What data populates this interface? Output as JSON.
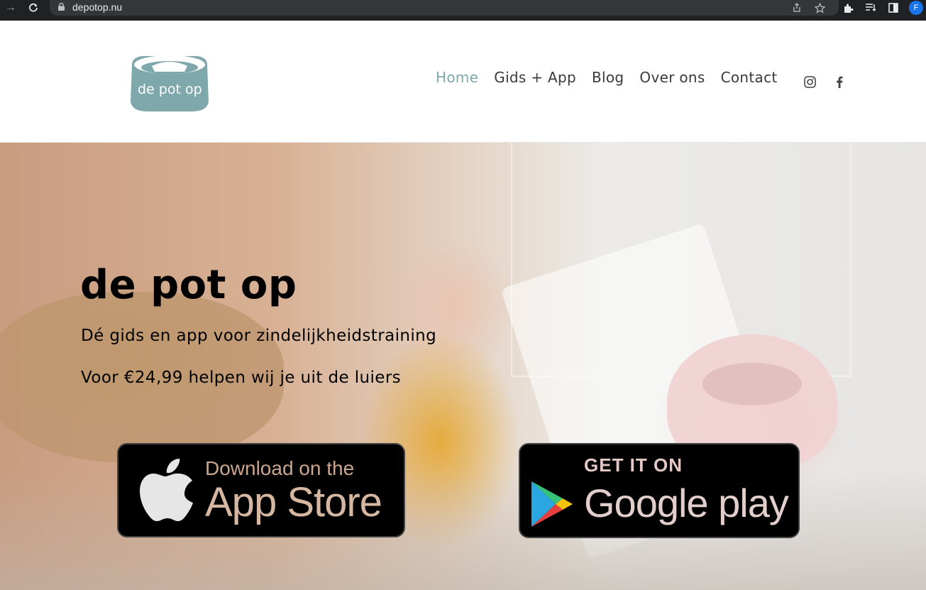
{
  "browser": {
    "url": "depotop.nu",
    "profile_initial": "F"
  },
  "header": {
    "logo_text": "de pot op",
    "nav": [
      {
        "label": "Home",
        "active": true
      },
      {
        "label": "Gids + App",
        "active": false
      },
      {
        "label": "Blog",
        "active": false
      },
      {
        "label": "Over ons",
        "active": false
      },
      {
        "label": "Contact",
        "active": false
      }
    ],
    "social": [
      "instagram-icon",
      "facebook-icon"
    ]
  },
  "hero": {
    "title": "de pot op",
    "subtitle": "Dé gids en app voor zindelijkheidstraining",
    "price_line": "Voor €24,99 helpen wij je uit de luiers"
  },
  "stores": {
    "appstore": {
      "small": "Download on the",
      "big": "App Store"
    },
    "playstore": {
      "small": "GET IT ON",
      "big": "Google play"
    }
  },
  "colors": {
    "accent": "#7ea8ac",
    "nav_text": "#3a3a3a",
    "logo": "#7ea8ac"
  }
}
